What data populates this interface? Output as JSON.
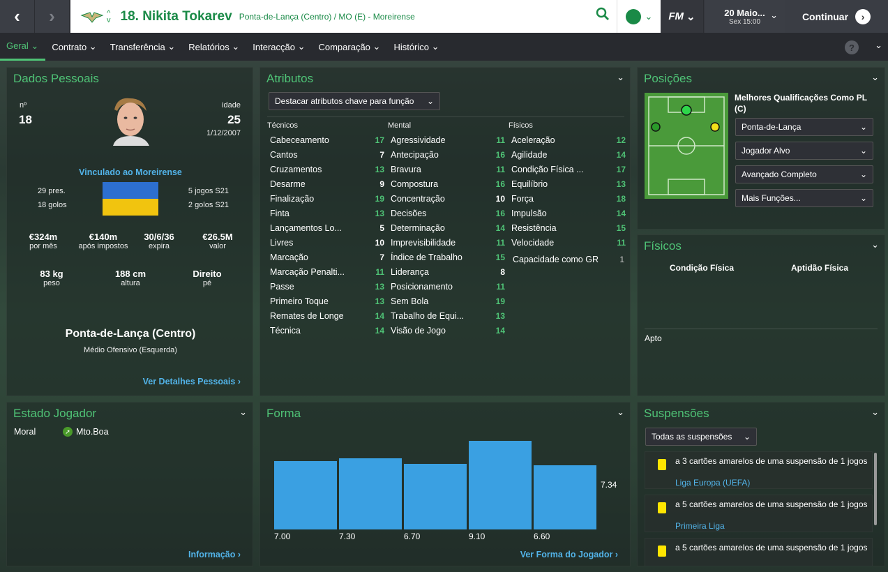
{
  "header": {
    "player_title": "18. Nikita Tokarev",
    "player_subtitle": "Ponta-de-Lança (Centro) / MO (E) - Moreirense",
    "fm_label": "FM",
    "date_line1": "20 Maio...",
    "date_line2": "Sex 15:00",
    "continue_label": "Continuar"
  },
  "tabs": [
    "Geral",
    "Contrato",
    "Transferência",
    "Relatórios",
    "Interacção",
    "Comparação",
    "Histórico"
  ],
  "personal": {
    "title": "Dados Pessoais",
    "number_label": "nº",
    "number": "18",
    "age_label": "idade",
    "age": "25",
    "dob": "1/12/2007",
    "club_link": "Vinculado ao Moreirense",
    "apps": "29 pres.",
    "goals": "18 golos",
    "u21_apps": "5 jogos S21",
    "u21_goals": "2 golos S21",
    "wage": "€324m",
    "wage_label": "por mês",
    "after_tax": "€140m",
    "after_tax_label": "após impostos",
    "expires": "30/6/36",
    "expires_label": "expira",
    "value": "€26.5M",
    "value_label": "valor",
    "weight": "83 kg",
    "weight_label": "peso",
    "height": "188 cm",
    "height_label": "altura",
    "foot": "Direito",
    "foot_label": "pé",
    "position": "Ponta-de-Lança (Centro)",
    "position2": "Médio Ofensivo (Esquerda)",
    "details_link": "Ver Detalhes Pessoais"
  },
  "attributes": {
    "title": "Atributos",
    "highlight_dropdown": "Destacar atributos chave para função",
    "col_headers": [
      "Técnicos",
      "Mental",
      "Físicos"
    ],
    "technical": [
      [
        "Cabeceamento",
        "17"
      ],
      [
        "Cantos",
        "7"
      ],
      [
        "Cruzamentos",
        "13"
      ],
      [
        "Desarme",
        "9"
      ],
      [
        "Finalização",
        "19"
      ],
      [
        "Finta",
        "13"
      ],
      [
        "Lançamentos Lo...",
        "5"
      ],
      [
        "Livres",
        "10"
      ],
      [
        "Marcação",
        "7"
      ],
      [
        "Marcação Penalti...",
        "11"
      ],
      [
        "Passe",
        "13"
      ],
      [
        "Primeiro Toque",
        "13"
      ],
      [
        "Remates de Longe",
        "14"
      ],
      [
        "Técnica",
        "14"
      ]
    ],
    "mental": [
      [
        "Agressividade",
        "11"
      ],
      [
        "Antecipação",
        "16"
      ],
      [
        "Bravura",
        "11"
      ],
      [
        "Compostura",
        "16"
      ],
      [
        "Concentração",
        "10"
      ],
      [
        "Decisões",
        "16"
      ],
      [
        "Determinação",
        "14"
      ],
      [
        "Imprevisibilidade",
        "11"
      ],
      [
        "Índice de Trabalho",
        "15"
      ],
      [
        "Liderança",
        "8"
      ],
      [
        "Posicionamento",
        "11"
      ],
      [
        "Sem Bola",
        "19"
      ],
      [
        "Trabalho de Equi...",
        "13"
      ],
      [
        "Visão de Jogo",
        "14"
      ]
    ],
    "physical": [
      [
        "Aceleração",
        "12"
      ],
      [
        "Agilidade",
        "14"
      ],
      [
        "Condição Física ...",
        "17"
      ],
      [
        "Equilíbrio",
        "13"
      ],
      [
        "Força",
        "18"
      ],
      [
        "Impulsão",
        "14"
      ],
      [
        "Resistência",
        "15"
      ],
      [
        "Velocidade",
        "11"
      ]
    ],
    "gk_label": "Capacidade como GR",
    "gk_value": "1"
  },
  "positions": {
    "title": "Posições",
    "best_label": "Melhores Qualificações Como PL (C)",
    "dropdowns": [
      "Ponta-de-Lança",
      "Jogador Alvo",
      "Avançado Completo",
      "Mais Funções..."
    ]
  },
  "physicals": {
    "title": "Físicos",
    "col1": "Condição Física",
    "col2": "Aptidão Física",
    "status": "Apto"
  },
  "state": {
    "title": "Estado Jogador",
    "morale_label": "Moral",
    "morale_value": "Mto.Boa",
    "info_link": "Informação"
  },
  "form": {
    "title": "Forma",
    "ratings": [
      7.0,
      7.3,
      6.7,
      9.1,
      6.6
    ],
    "rating_labels": [
      "7.00",
      "7.30",
      "6.70",
      "9.10",
      "6.60"
    ],
    "average": "7.34",
    "link": "Ver Forma do Jogador"
  },
  "suspensions": {
    "title": "Suspensões",
    "dropdown": "Todas as suspensões",
    "items": [
      {
        "text": "a 3 cartões amarelos de uma suspensão de 1 jogos",
        "comp": "Liga Europa (UEFA)"
      },
      {
        "text": "a 5 cartões amarelos de uma suspensão de 1 jogos",
        "comp": "Primeira Liga"
      },
      {
        "text": "a 5 cartões amarelos de uma suspensão de 1 jogos",
        "comp": ""
      }
    ]
  },
  "colors": {
    "accent": "#4fc376",
    "link": "#52b3e8",
    "bar": "#3aa0e2"
  }
}
